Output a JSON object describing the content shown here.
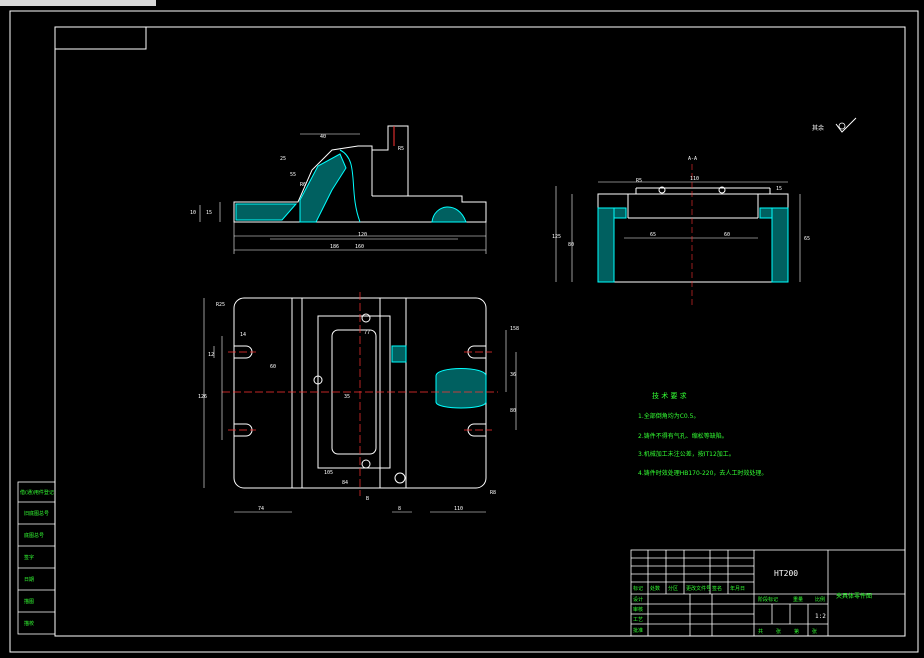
{
  "tab_strip": "",
  "notes": {
    "title": "技 术 要 求",
    "items": [
      "1.全部倒角均为C0.5。",
      "2.铸件不得有气孔、缩松等缺陷。",
      "3.机械加工未注公差，按IT12加工。",
      "4.铸件时效处理HB170-220，去人工时效处理。"
    ]
  },
  "title_block": {
    "material": "HT200",
    "part_name": "夹具体零件图",
    "scale": "1:2",
    "sheet_cells": [
      "共",
      "张",
      "第",
      "张"
    ],
    "header_cells": [
      "标记",
      "处数",
      "分区",
      "更改文件号",
      "签名",
      "年月日"
    ],
    "role_cells": [
      "设计",
      "审核",
      "工艺",
      "批准"
    ],
    "stage_label": "阶段标记",
    "weight_label": "重量",
    "scale_label": "比例"
  },
  "side_table": [
    "借(通)用件登记",
    "旧底图总号",
    "底图总号",
    "签字",
    "日期",
    "描图",
    "描校"
  ],
  "surface_mark": "其余",
  "views": {
    "section_A_label": "A-A",
    "view_label": "B"
  },
  "dimensions": {
    "front": [
      "186",
      "R6",
      "R5",
      "55",
      "40",
      "15",
      "10",
      "120",
      "160",
      "25"
    ],
    "side": [
      "110",
      "R5",
      "65",
      "60",
      "125",
      "80",
      "15",
      "65"
    ],
    "plan": [
      "R25",
      "14",
      "12",
      "126",
      "60",
      "36",
      "80",
      "158",
      "74",
      "110",
      "77",
      "35",
      "105",
      "84",
      "8",
      "R8"
    ]
  }
}
